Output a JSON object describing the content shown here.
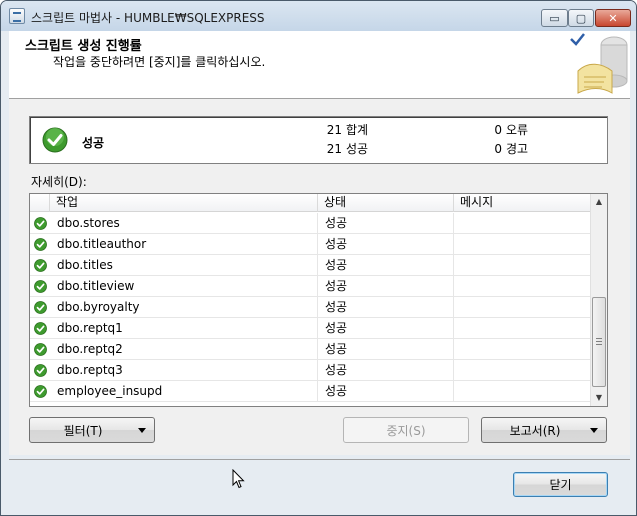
{
  "window": {
    "title": "스크립트 마법사 - HUMBLE₩SQLEXPRESS",
    "min_glyph": "▭",
    "max_glyph": "▢",
    "close_glyph": "✕"
  },
  "header": {
    "title": "스크립트 생성 진행률",
    "subtitle": "작업을 중단하려면 [중지]를 클릭하십시오."
  },
  "status": {
    "result": "성공",
    "total_count": "21",
    "total_label": "합계",
    "success_count": "21",
    "success_label": "성공",
    "error_count": "0",
    "error_label": "오류",
    "warning_count": "0",
    "warning_label": "경고"
  },
  "details": {
    "label": "자세히(D):",
    "columns": {
      "task": "작업",
      "state": "상태",
      "message": "메시지"
    },
    "rows": [
      {
        "task": "dbo.stores",
        "state": "성공",
        "message": ""
      },
      {
        "task": "dbo.titleauthor",
        "state": "성공",
        "message": ""
      },
      {
        "task": "dbo.titles",
        "state": "성공",
        "message": ""
      },
      {
        "task": "dbo.titleview",
        "state": "성공",
        "message": ""
      },
      {
        "task": "dbo.byroyalty",
        "state": "성공",
        "message": ""
      },
      {
        "task": "dbo.reptq1",
        "state": "성공",
        "message": ""
      },
      {
        "task": "dbo.reptq2",
        "state": "성공",
        "message": ""
      },
      {
        "task": "dbo.reptq3",
        "state": "성공",
        "message": ""
      },
      {
        "task": "employee_insupd",
        "state": "성공",
        "message": ""
      }
    ]
  },
  "buttons": {
    "filter": "필터(T)",
    "stop": "중지(S)",
    "report": "보고서(R)",
    "close": "닫기"
  },
  "icons": {
    "success": "check-circle-icon",
    "accent": "#3e9b2e"
  }
}
